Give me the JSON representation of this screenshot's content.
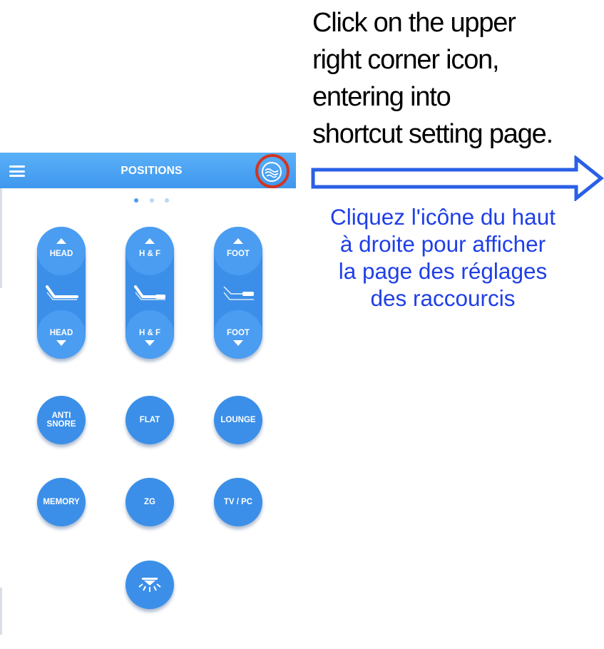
{
  "instructions": {
    "english_lines": [
      "Click on the upper",
      "right corner icon,",
      "entering into",
      "shortcut setting page."
    ],
    "french_lines": [
      "Cliquez l'icône du haut",
      "à droite pour afficher",
      "la page des réglages",
      "des raccourcis"
    ]
  },
  "header": {
    "title": "POSITIONS",
    "menu_icon": "hamburger-icon",
    "corner_icon": "shortcut-settings-icon",
    "highlight_color": "#d23520"
  },
  "pager": {
    "pages": 3,
    "active": 0
  },
  "adjust_buttons": [
    {
      "up_label": "HEAD",
      "down_label": "HEAD",
      "icon": "bed-head-icon"
    },
    {
      "up_label": "H & F",
      "down_label": "H & F",
      "icon": "bed-head-foot-icon"
    },
    {
      "up_label": "FOOT",
      "down_label": "FOOT",
      "icon": "bed-foot-icon"
    }
  ],
  "preset_buttons": [
    {
      "label_line1": "ANTI",
      "label_line2": "SNORE"
    },
    {
      "label_line1": "FLAT"
    },
    {
      "label_line1": "LOUNGE"
    },
    {
      "label_line1": "MEMORY"
    },
    {
      "label_line1": "ZG"
    },
    {
      "label_line1": "TV / PC"
    }
  ],
  "light_button": {
    "icon": "light-icon"
  },
  "colors": {
    "header_blue": "#4aa3f3",
    "button_blue": "#3b8fe8",
    "arrow_blue": "#2a5fe6",
    "french_text": "#1f3fe6"
  }
}
